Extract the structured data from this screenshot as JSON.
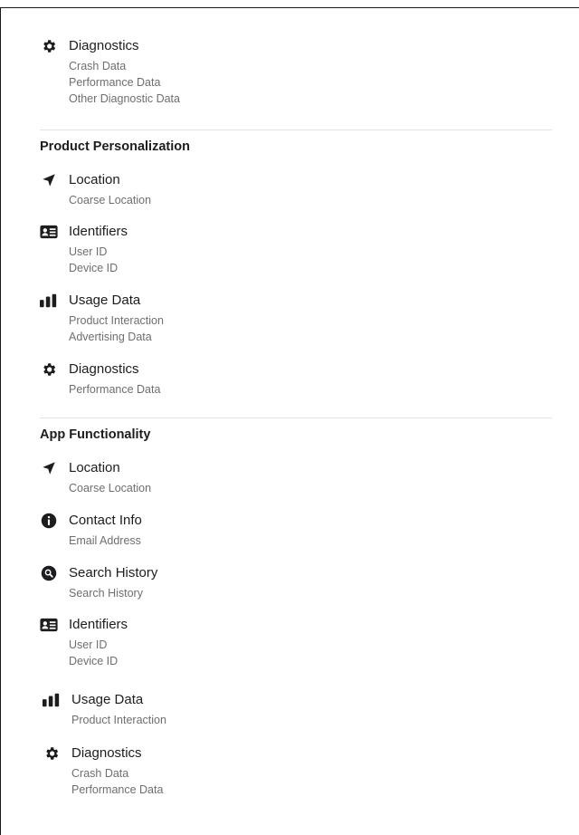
{
  "sections": [
    {
      "heading": "",
      "items": [
        {
          "icon": "gear-icon",
          "title": "Diagnostics",
          "subs": [
            "Crash Data",
            "Performance Data",
            "Other Diagnostic Data"
          ]
        }
      ]
    },
    {
      "heading": "Product Personalization",
      "items": [
        {
          "icon": "location-arrow-icon",
          "title": "Location",
          "subs": [
            "Coarse Location"
          ]
        },
        {
          "icon": "id-card-icon",
          "title": "Identifiers",
          "subs": [
            "User ID",
            "Device ID"
          ]
        },
        {
          "icon": "bar-chart-icon",
          "title": "Usage Data",
          "subs": [
            "Product Interaction",
            "Advertising Data"
          ]
        },
        {
          "icon": "gear-icon",
          "title": "Diagnostics",
          "subs": [
            "Performance Data"
          ]
        }
      ]
    },
    {
      "heading": "App Functionality",
      "items": [
        {
          "icon": "location-arrow-icon",
          "title": "Location",
          "subs": [
            "Coarse Location"
          ]
        },
        {
          "icon": "info-circle-icon",
          "title": "Contact Info",
          "subs": [
            "Email Address"
          ]
        },
        {
          "icon": "search-icon",
          "title": "Search History",
          "subs": [
            "Search History"
          ]
        },
        {
          "icon": "id-card-icon",
          "title": "Identifiers",
          "subs": [
            "User ID",
            "Device ID"
          ]
        },
        {
          "icon": "bar-chart-icon",
          "title": "Usage Data",
          "subs": [
            "Product Interaction"
          ]
        },
        {
          "icon": "gear-icon",
          "title": "Diagnostics",
          "subs": [
            "Crash Data",
            "Performance Data"
          ]
        }
      ]
    }
  ]
}
